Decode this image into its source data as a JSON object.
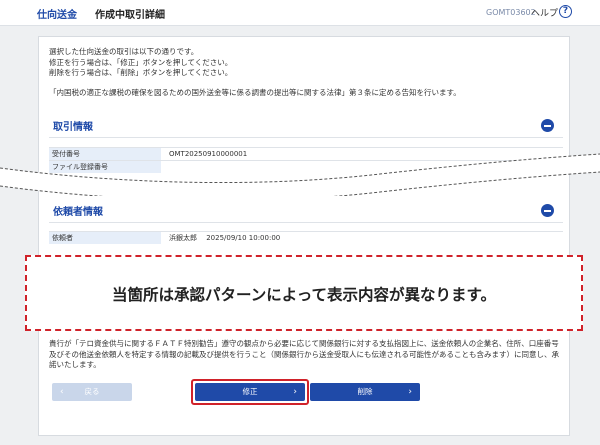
{
  "header": {
    "service": "仕向送金",
    "title": "作成中取引詳細",
    "screen_id": "GOMT03602",
    "help_label": "ヘルプ",
    "help_icon": "?"
  },
  "intro": {
    "line1": "選択した仕向送金の取引は以下の通りです。",
    "line2": "修正を行う場合は、「修正」ボタンを押してください。",
    "line3": "削除を行う場合は、「削除」ボタンを押してください。",
    "law": "「内国税の適正な課税の確保を図るための国外送金等に係る調書の提出等に関する法律」第３条に定める告知を行います。"
  },
  "sections": {
    "transaction": {
      "title": "取引情報",
      "rows": [
        {
          "label": "受付番号",
          "value": "OMT20250910000001"
        },
        {
          "label": "ファイル登録番号",
          "value": ""
        }
      ]
    },
    "requester": {
      "title": "依頼者情報",
      "rows": [
        {
          "label": "依頼者",
          "value": "浜銀太郎　 2025/09/10 10:00:00"
        }
      ]
    }
  },
  "notice": "当箇所は承認パターンによって表示内容が異なります。",
  "fatf": "貴行が「テロ資金供与に関するＦＡＴＦ特別勧告」遵守の観点から必要に応じて関係銀行に対する支払指図上に、送金依頼人の企業名、住所、口座番号及びその他送金依頼人を特定する情報の記載及び提供を行うこと（関係銀行から送金受取人にも伝達される可能性があることも含みます）に同意し、承諾いたします。",
  "buttons": {
    "back": "戻る",
    "edit": "修正",
    "delete": "削除"
  },
  "colors": {
    "primary": "#1f4aa8",
    "highlight": "#d0222a",
    "label_bg": "#e6eef9"
  }
}
